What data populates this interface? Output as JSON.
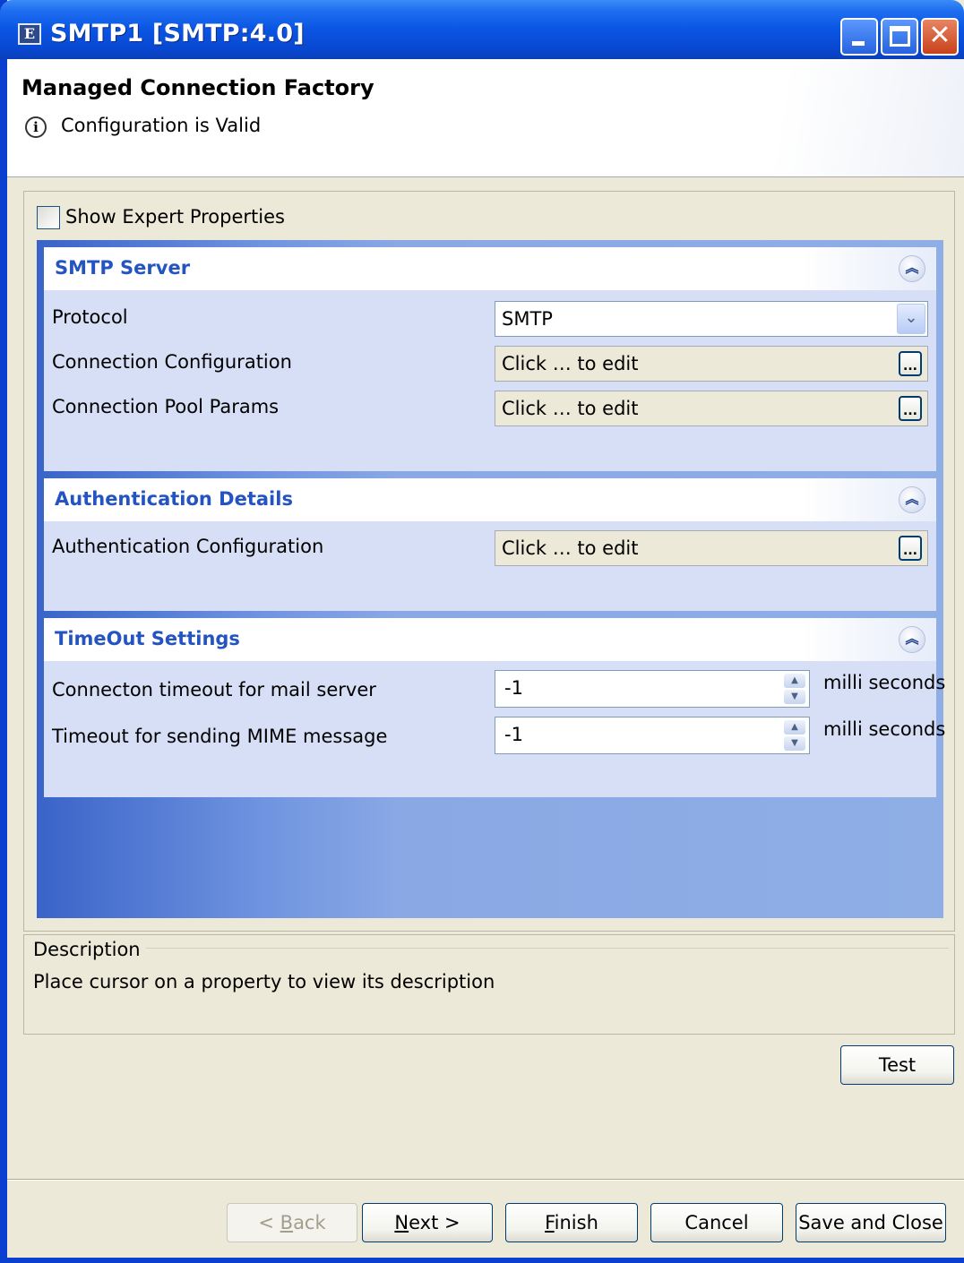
{
  "window": {
    "title": "SMTP1 [SMTP:4.0]",
    "icon_letter": "E"
  },
  "header": {
    "title": "Managed Connection Factory",
    "status": "Configuration is Valid"
  },
  "expert": {
    "label": "Show Expert Properties",
    "checked": false
  },
  "sections": {
    "smtp": {
      "title": "SMTP Server",
      "protocol_label": "Protocol",
      "protocol_value": "SMTP",
      "conn_config_label": "Connection Configuration",
      "conn_config_value": "Click … to edit",
      "pool_label": "Connection Pool Params",
      "pool_value": "Click … to edit"
    },
    "auth": {
      "title": "Authentication Details",
      "auth_label": "Authentication Configuration",
      "auth_value": "Click … to edit"
    },
    "timeout": {
      "title": "TimeOut Settings",
      "conn_timeout_label": "Connecton timeout for mail server",
      "conn_timeout_value": "-1",
      "conn_timeout_unit": "milli seconds",
      "mime_timeout_label": "Timeout for sending MIME message",
      "mime_timeout_value": "-1",
      "mime_timeout_unit": "milli seconds"
    }
  },
  "description": {
    "title": "Description",
    "text": "Place cursor on a property to view its description"
  },
  "buttons": {
    "test": "Test",
    "back_prefix": "< ",
    "back_mnemonic": "B",
    "back_rest": "ack",
    "next_mnemonic": "N",
    "next_rest": "ext >",
    "finish_mnemonic": "F",
    "finish_rest": "inish",
    "cancel": "Cancel",
    "save_close": "Save and Close"
  },
  "colors": {
    "title_bar": "#0a55e3",
    "section_title": "#2453c2",
    "section_bg": "#d6dff5",
    "dialog_bg": "#ece9d8"
  }
}
